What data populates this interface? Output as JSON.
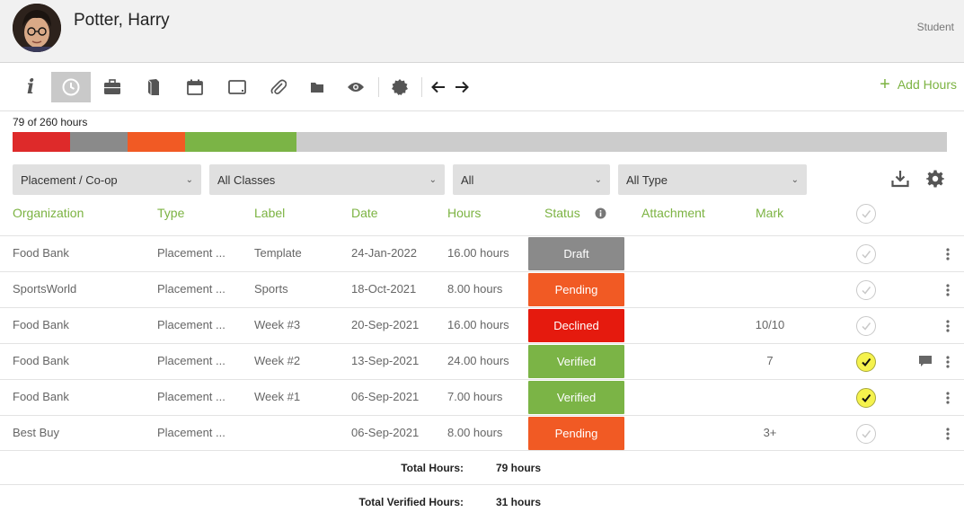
{
  "header": {
    "name": "Potter, Harry",
    "role": "Student"
  },
  "toolbar": {
    "tools": [
      "info-icon",
      "clock-icon",
      "briefcase-icon",
      "book-icon",
      "calendar-icon",
      "tablet-icon",
      "paperclip-icon",
      "folder-icon",
      "eye-icon",
      "badge-icon",
      "arrow-left-icon",
      "arrow-right-icon"
    ],
    "active_tool": "clock-icon",
    "add_hours_label": "Add Hours"
  },
  "progress": {
    "label": "79 of 260 hours",
    "segments": [
      {
        "status": "Declined",
        "hours": 16,
        "color": "#de2a2a"
      },
      {
        "status": "Draft",
        "hours": 16,
        "color": "#8a8a8a"
      },
      {
        "status": "Pending",
        "hours": 16,
        "color": "#f15a24"
      },
      {
        "status": "Verified",
        "hours": 31,
        "color": "#7bb446"
      }
    ],
    "total": 260
  },
  "filters": {
    "program": "Placement / Co-op",
    "classes": "All Classes",
    "status": "All",
    "type": "All Type"
  },
  "table": {
    "headers": {
      "organization": "Organization",
      "type": "Type",
      "label": "Label",
      "date": "Date",
      "hours": "Hours",
      "status": "Status",
      "attachment": "Attachment",
      "mark": "Mark"
    },
    "rows": [
      {
        "organization": "Food Bank",
        "type": "Placement ...",
        "label": "Template",
        "date": "24-Jan-2022",
        "hours": "16.00 hours",
        "status": "Draft",
        "mark": "",
        "checked": false,
        "comment": false
      },
      {
        "organization": "SportsWorld",
        "type": "Placement ...",
        "label": "Sports",
        "date": "18-Oct-2021",
        "hours": "8.00 hours",
        "status": "Pending",
        "mark": "",
        "checked": false,
        "comment": false
      },
      {
        "organization": "Food Bank",
        "type": "Placement ...",
        "label": "Week #3",
        "date": "20-Sep-2021",
        "hours": "16.00 hours",
        "status": "Declined",
        "mark": "10/10",
        "checked": false,
        "comment": false
      },
      {
        "organization": "Food Bank",
        "type": "Placement ...",
        "label": "Week #2",
        "date": "13-Sep-2021",
        "hours": "24.00 hours",
        "status": "Verified",
        "mark": "7",
        "checked": true,
        "comment": true
      },
      {
        "organization": "Food Bank",
        "type": "Placement ...",
        "label": "Week #1",
        "date": "06-Sep-2021",
        "hours": "7.00 hours",
        "status": "Verified",
        "mark": "",
        "checked": true,
        "comment": false
      },
      {
        "organization": "Best Buy",
        "type": "Placement ...",
        "label": "",
        "date": "06-Sep-2021",
        "hours": "8.00 hours",
        "status": "Pending",
        "mark": "3+",
        "checked": false,
        "comment": false
      }
    ]
  },
  "status_colors": {
    "Draft": "#8a8a8a",
    "Pending": "#f15a24",
    "Declined": "#e51a0e",
    "Verified": "#7bb446"
  },
  "totals": {
    "total_label": "Total Hours:",
    "total_value": "79 hours",
    "verified_label": "Total Verified Hours:",
    "verified_value": "31 hours"
  }
}
